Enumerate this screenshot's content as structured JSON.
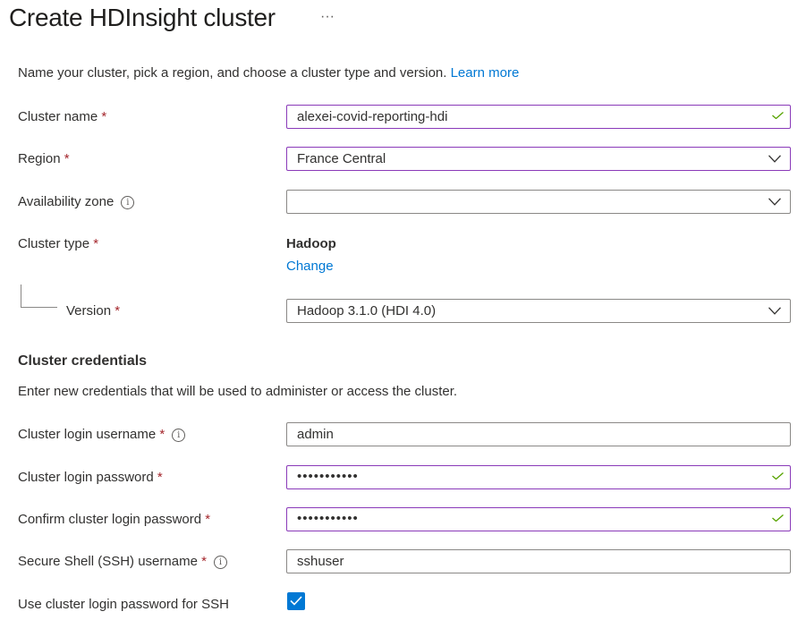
{
  "page": {
    "title": "Create HDInsight cluster",
    "more_label": "···",
    "intro": "Name your cluster, pick a region, and choose a cluster type and version.",
    "learn_more": "Learn more"
  },
  "basics": {
    "cluster_name": {
      "label": "Cluster name",
      "required": "*",
      "value": "alexei-covid-reporting-hdi"
    },
    "region": {
      "label": "Region",
      "required": "*",
      "value": "France Central"
    },
    "availability_zone": {
      "label": "Availability zone",
      "value": ""
    },
    "cluster_type": {
      "label": "Cluster type",
      "required": "*",
      "value": "Hadoop",
      "change_label": "Change"
    },
    "version": {
      "label": "Version",
      "required": "*",
      "value": "Hadoop 3.1.0 (HDI 4.0)"
    }
  },
  "credentials": {
    "heading": "Cluster credentials",
    "description": "Enter new credentials that will be used to administer or access the cluster.",
    "login_username": {
      "label": "Cluster login username",
      "required": "*",
      "value": "admin"
    },
    "login_password": {
      "label": "Cluster login password",
      "required": "*",
      "value": "•••••••••••"
    },
    "confirm_password": {
      "label": "Confirm cluster login password",
      "required": "*",
      "value": "•••••••••••"
    },
    "ssh_username": {
      "label": "Secure Shell (SSH) username",
      "required": "*",
      "value": "sshuser"
    },
    "use_login_password_for_ssh": {
      "label": "Use cluster login password for SSH",
      "checked": true
    }
  },
  "icons": {
    "info": "info-icon",
    "check": "checkmark-icon",
    "chevron": "chevron-down-icon"
  },
  "colors": {
    "accent": "#0078d4",
    "valid_border": "#8a3ab9",
    "valid_check": "#57a300",
    "required": "#a4262c"
  }
}
